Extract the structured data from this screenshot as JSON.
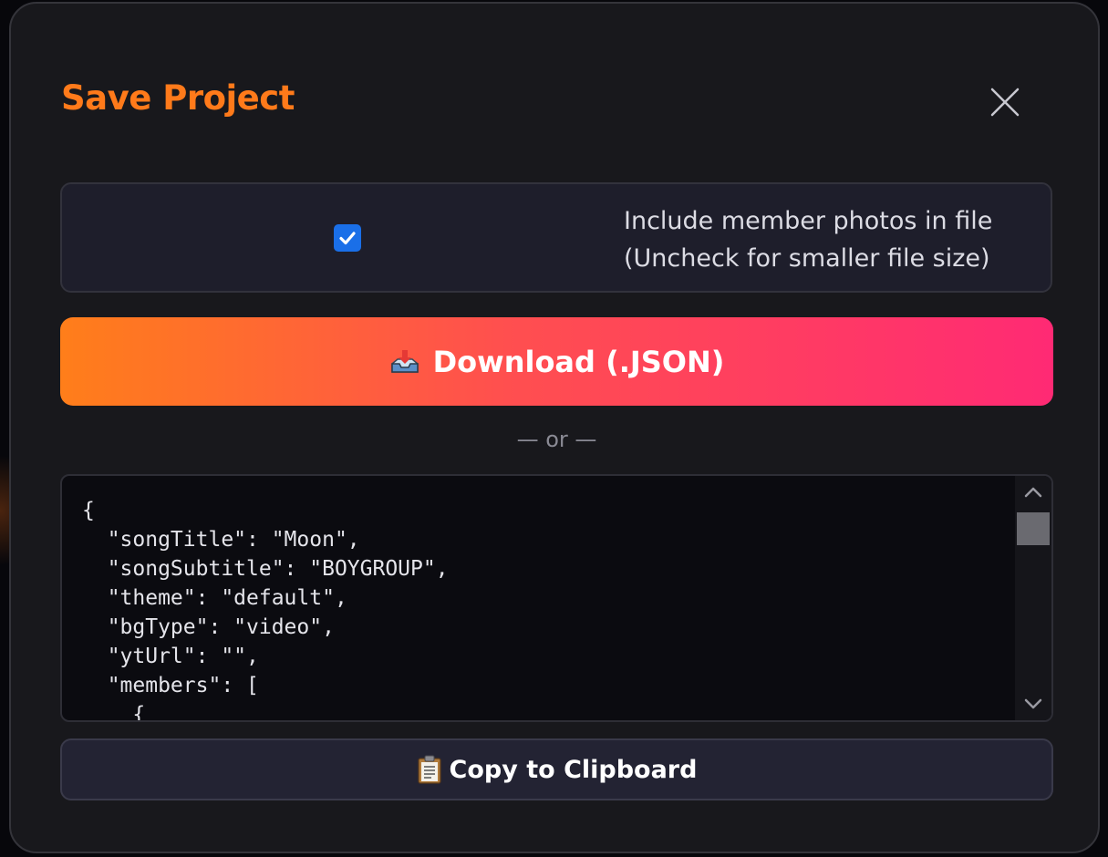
{
  "dialog": {
    "title": "Save Project",
    "close_icon": "close-icon"
  },
  "option": {
    "checked": true,
    "label_line1": "Include member photos in file",
    "label_line2": "(Uncheck for smaller file size)"
  },
  "download": {
    "icon": "inbox-tray-icon",
    "label": "Download (.JSON)"
  },
  "divider": {
    "text": "— or —"
  },
  "json_preview": {
    "lines": [
      "{",
      "  \"songTitle\": \"Moon\",",
      "  \"songSubtitle\": \"BOYGROUP\",",
      "  \"theme\": \"default\",",
      "  \"bgType\": \"video\",",
      "  \"ytUrl\": \"\",",
      "  \"members\": [",
      "    {"
    ]
  },
  "copy": {
    "icon": "clipboard-icon",
    "label": "Copy to Clipboard"
  },
  "colors": {
    "title_accent": "#ff7a1a",
    "gradient_start": "#ff7e1a",
    "gradient_end": "#ff2a74",
    "checkbox": "#1a6fe8"
  }
}
